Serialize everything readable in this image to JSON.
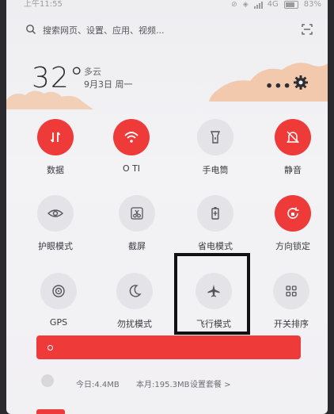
{
  "status": {
    "time": "上午11:55",
    "network": "4G",
    "battery": "83%"
  },
  "search": {
    "placeholder": "搜索网页、设置、应用、视频..."
  },
  "weather": {
    "temperature": "32°",
    "condition": "多云",
    "date": "9月3日 周一"
  },
  "tiles": [
    {
      "label": "数据",
      "icon": "data-arrows-icon",
      "state": "on"
    },
    {
      "label": "O TI",
      "icon": "wifi-icon",
      "state": "on"
    },
    {
      "label": "手电筒",
      "icon": "flashlight-icon",
      "state": "off"
    },
    {
      "label": "静音",
      "icon": "bell-mute-icon",
      "state": "on"
    },
    {
      "label": "护眼模式",
      "icon": "eye-icon",
      "state": "off"
    },
    {
      "label": "截屏",
      "icon": "scissors-icon",
      "state": "off"
    },
    {
      "label": "省电模式",
      "icon": "battery-icon",
      "state": "off"
    },
    {
      "label": "方向锁定",
      "icon": "rotation-lock-icon",
      "state": "on"
    },
    {
      "label": "GPS",
      "icon": "gps-icon",
      "state": "off"
    },
    {
      "label": "勿扰模式",
      "icon": "moon-icon",
      "state": "off"
    },
    {
      "label": "飞行模式",
      "icon": "airplane-icon",
      "state": "off"
    },
    {
      "label": "开关排序",
      "icon": "grid-icon",
      "state": "off"
    }
  ],
  "data_usage": {
    "today": "今日:4.4MB",
    "month": "本月:195.3MB",
    "settings": "设置套餐 >"
  },
  "colors": {
    "accent": "#ef3a3a",
    "tile_off": "#e4e3e7"
  }
}
